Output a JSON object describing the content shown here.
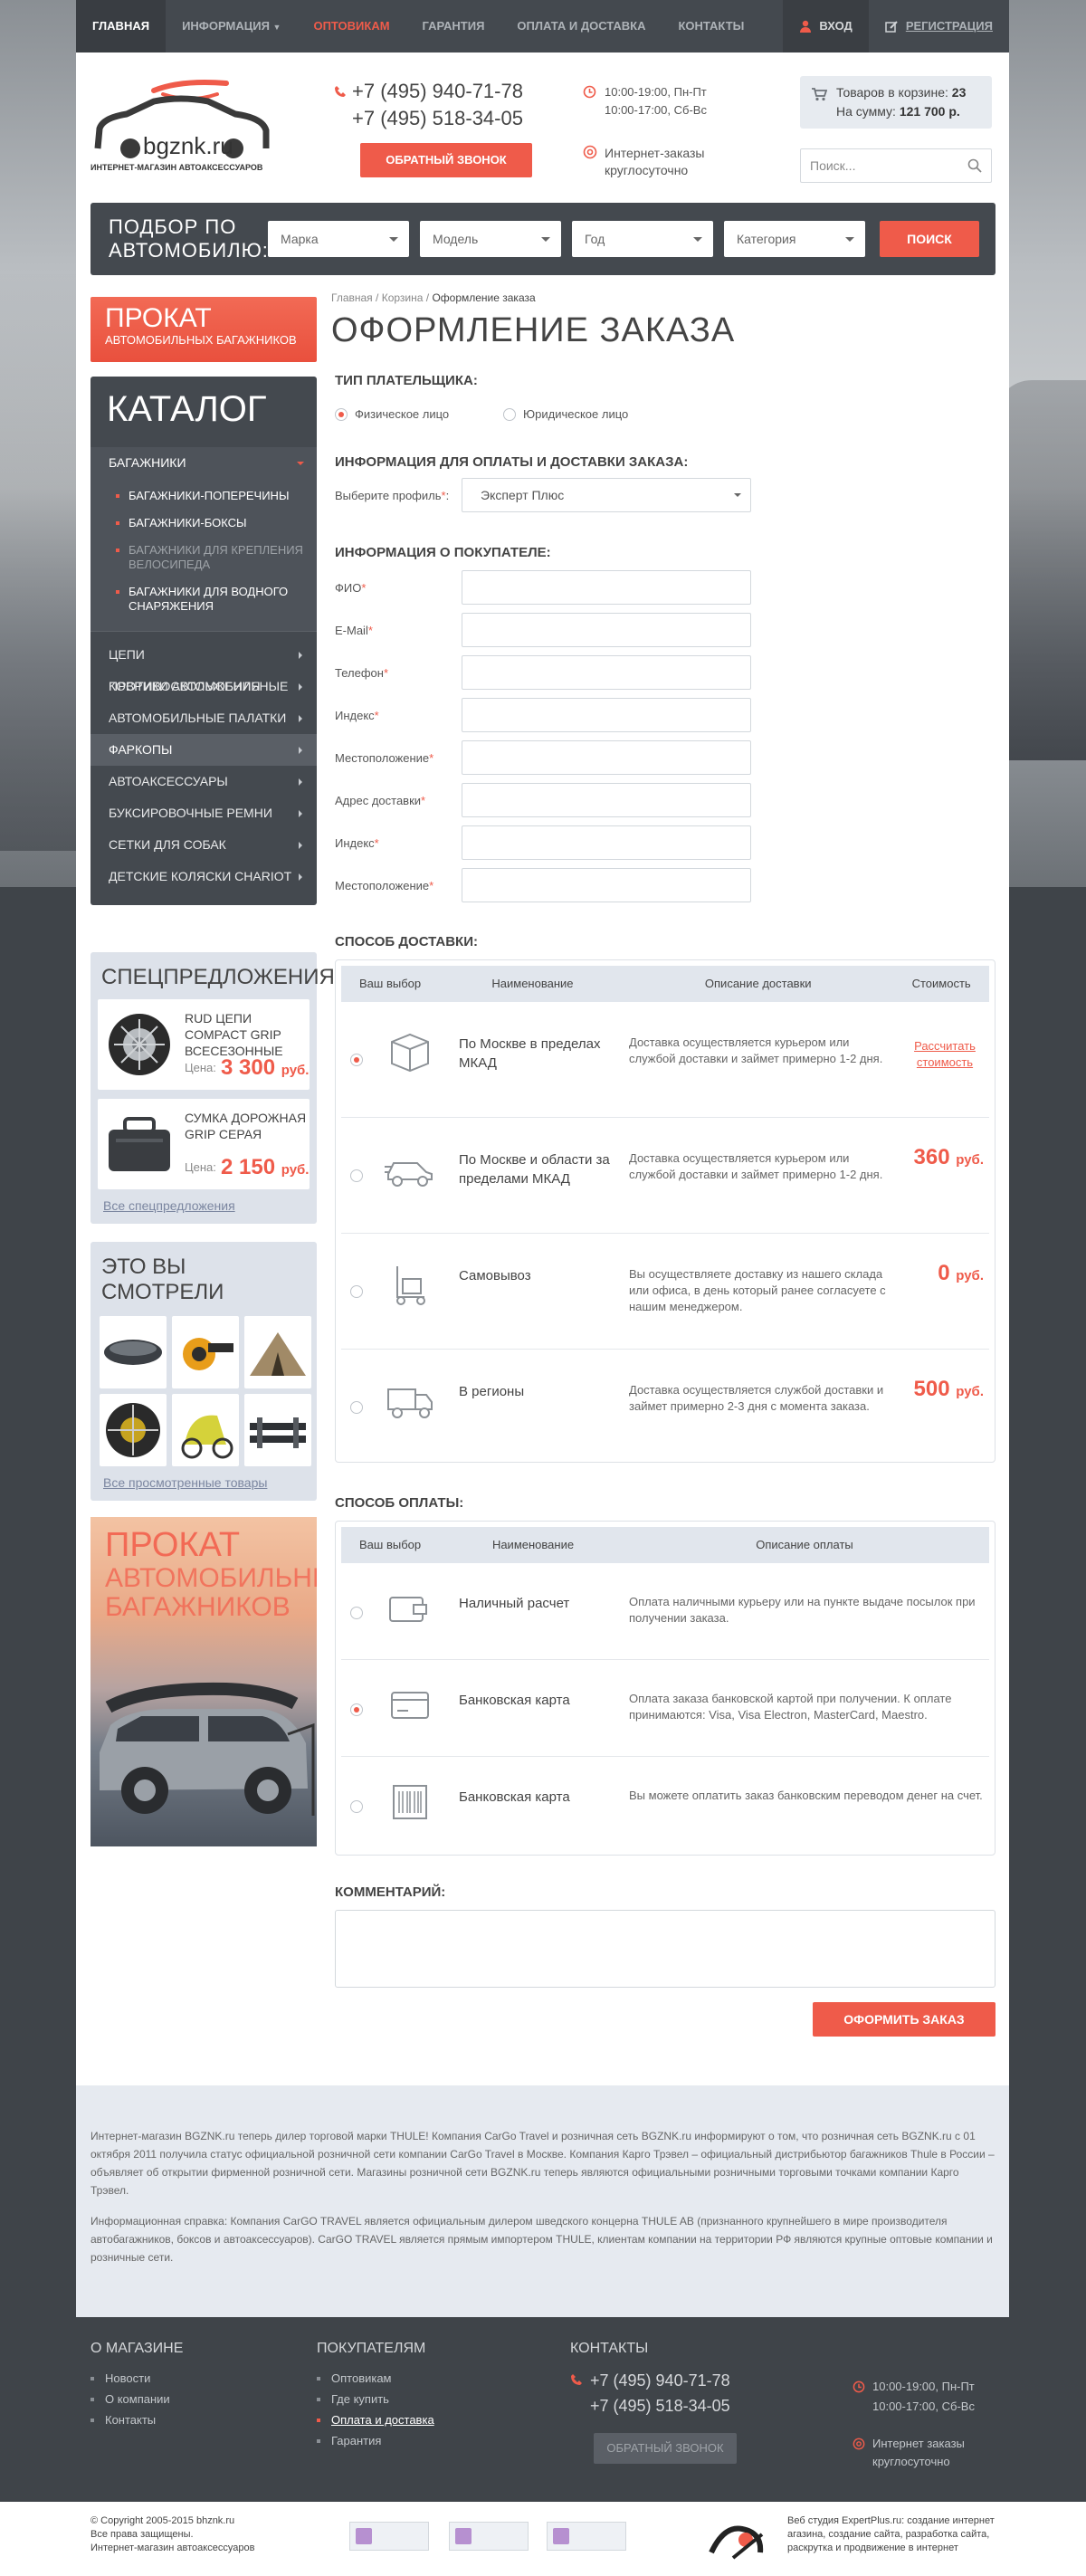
{
  "topnav": {
    "items": [
      "Главная",
      "Информация",
      "Оптовикам",
      "Гарантия",
      "Оплата и доставка",
      "Контакты"
    ],
    "login": "Вход",
    "register": "Регистрация"
  },
  "header": {
    "logo_text": "bgznk.ru",
    "logo_tagline": "ИНТЕРНЕТ-МАГАЗИН АВТОАКСЕССУАРОВ",
    "phone1": "+7 (495) 940-71-78",
    "phone2": "+7 (495) 518-34-05",
    "callback": "Обратный звонок",
    "hours1": "10:00-19:00, Пн-Пт",
    "hours2": "10:00-17:00, Сб-Вс",
    "online1": "Интернет-заказы",
    "online2": "круглосуточно",
    "cart_label": "Товаров в корзине:",
    "cart_count": "23",
    "cart_sum_label": "На сумму:",
    "cart_sum": "121 700 р.",
    "search_placeholder": "Поиск..."
  },
  "picker": {
    "title1": "Подбор по",
    "title2": "автомобилю:",
    "make": "Марка",
    "model": "Модель",
    "year": "Год",
    "category": "Категория",
    "button": "Поиск"
  },
  "sidebar": {
    "rent_title": "Прокат",
    "rent_subtitle": "автомобильных багажников",
    "catalog_title": "Каталог",
    "open_item": "Багажники",
    "sub_items": [
      "Багажники-поперечины",
      "Багажники-боксы",
      "Багажники для крепления велосипеда",
      "Багажники для водного снаряжения"
    ],
    "items": [
      "Цепи противоскольжения",
      "Коврики автомобильные",
      "Автомобильные палатки",
      "Фаркопы",
      "Автоаксессуары",
      "Буксировочные ремни",
      "Сетки для собак",
      "Детские коляски Chariot"
    ],
    "specials_title": "Спецпредложения",
    "offers": [
      {
        "name": "RUD цепи Compact Grip всесезонные",
        "price_label": "Цена:",
        "price": "3 300",
        "currency": "руб."
      },
      {
        "name": "Сумка дорожная Grip серая",
        "price_label": "Цена:",
        "price": "2 150",
        "currency": "руб."
      }
    ],
    "all_specials": "Все спецпредложения",
    "viewed_title": "Это вы смотрели",
    "all_viewed": "Все просмотренные товары",
    "ad_title": "Прокат",
    "ad_subtitle": "автомобильных багажников"
  },
  "main": {
    "breadcrumbs": [
      "Главная",
      "Корзина",
      "Оформление заказа"
    ],
    "title": "Оформление заказа",
    "payer_type_title": "Тип плательщика:",
    "payer_types": [
      "Физическое лицо",
      "Юридическое лицо"
    ],
    "payment_info_title": "Информация для оплаты и доставки заказа:",
    "profile_label": "Выберите профиль",
    "profile_value": "Эксперт Плюс",
    "buyer_title": "Информация о покупателе:",
    "fields": [
      "ФИО",
      "E-Mail",
      "Телефон",
      "Индекс",
      "Местоположение",
      "Адрес доставки",
      "Индекс",
      "Местоположение"
    ],
    "delivery_title": "Способ доставки:",
    "delivery_headers": [
      "Ваш выбор",
      "Наименование",
      "Описание доставки",
      "Стоимость"
    ],
    "delivery": [
      {
        "name": "По Москве в пределах МКАД",
        "desc": "Доставка осуществляется курьером или службой доставки и займет примерно 1-2 дня.",
        "price": "Рассчитать стоимость",
        "icon": "box-icon"
      },
      {
        "name": "По Москве и области за пределами МКАД",
        "desc": "Доставка осуществляется курьером или службой доставки и займет примерно 1-2 дня.",
        "price": "360",
        "currency": "руб.",
        "icon": "car-icon"
      },
      {
        "name": "Самовывоз",
        "desc": "Вы осуществляете доставку из нашего склада или офиса, в день который ранее согласуете с нашим менеджером.",
        "price": "0",
        "currency": "руб.",
        "icon": "cart-icon"
      },
      {
        "name": "В регионы",
        "desc": "Доставка осуществляется службой доставки и займет примерно 2-3 дня с момента заказа.",
        "price": "500",
        "currency": "руб.",
        "icon": "truck-icon"
      }
    ],
    "payment_title": "Способ оплаты:",
    "payment_headers": [
      "Ваш выбор",
      "Наименование",
      "Описание оплаты"
    ],
    "payments": [
      {
        "name": "Наличный расчет",
        "desc": "Оплата наличными курьеру или на пункте выдаче посылок при получении заказа.",
        "icon": "wallet-icon"
      },
      {
        "name": "Банковская карта",
        "desc": "Оплата заказа банковской картой при получении. К оплате принимаются: Visa, Visa Electron, MasterCard, Maestro.",
        "icon": "card-icon"
      },
      {
        "name": "Банковская карта",
        "desc": "Вы можете оплатить заказ банковским переводом денег на счет.",
        "icon": "barcode-icon"
      }
    ],
    "comment_title": "Комментарий:",
    "submit": "Оформить заказ"
  },
  "about": {
    "p1": "Интернет-магазин BGZNK.ru теперь дилер торговой марки THULE! Компания CarGo Travel и розничная сеть BGZNK.ru информируют о том, что розничная сеть BGZNK.ru с 01 октября 2011 получила статус официальной розничной сети компании CarGo Travel в Москве. Компания Карго Трэвел – официальный дистрибьютор багажников Thule в России – объявляет об открытии фирменной розничной сети. Магазины розничной сети BGZNK.ru теперь являются официальными розничными торговыми точками компании Карго Трэвел.",
    "p2": "Информационная справка: Компания CarGO TRAVEL является официальным дилером шведского концерна THULE AB (признанного крупнейшего в мире производителя автобагажников, боксов и автоаксессуаров). CarGO TRAVEL является прямым импортером THULE, клиентам компании на территории РФ являются крупные оптовые компании и розничные сети."
  },
  "footer": {
    "shop_title": "О магазине",
    "shop_links": [
      "Новости",
      "О компании",
      "Контакты"
    ],
    "buyers_title": "Покупателям",
    "buyers_links": [
      "Оптовикам",
      "Где купить",
      "Оплата и доставка",
      "Гарантия"
    ],
    "contacts_title": "Контакты",
    "phone1": "+7 (495) 940-71-78",
    "phone2": "+7 (495) 518-34-05",
    "callback": "Обратный звонок",
    "hours1": "10:00-19:00, Пн-Пт",
    "hours2": "10:00-17:00, Сб-Вс",
    "online1": "Интернет заказы",
    "online2": "круглосуточно",
    "copy1": "© Copyright 2005-2015 bhznk.ru",
    "copy2": "Все права защищены.",
    "copy3": "Интернет-магазин автоаксессуаров",
    "studio1": "Веб студия ExpertPlus.ru: создание интернет",
    "studio2": "агазина, создание сайта, разработка сайта,",
    "studio3": "раскрутка и продвижение в интернет"
  },
  "colors": {
    "accent": "#ef5b4a",
    "dark": "#44494f",
    "light": "#e1e6ed"
  }
}
